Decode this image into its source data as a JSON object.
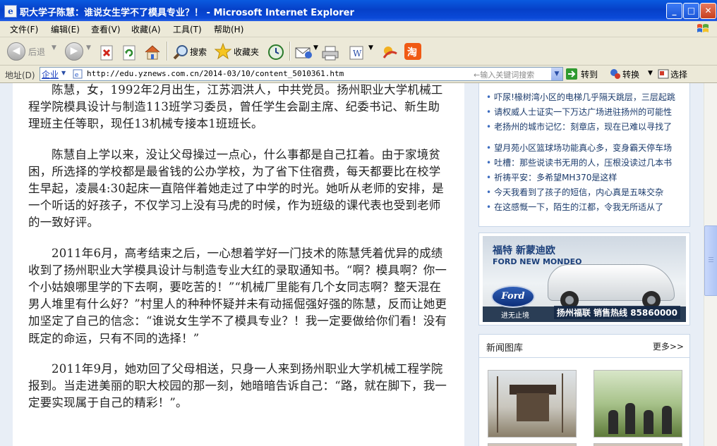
{
  "window": {
    "title": "职大学子陈慧：谁说女生学不了模具专业？！ - Microsoft Internet Explorer",
    "icon": "ie-page-icon",
    "buttons": [
      "minimize",
      "maximize",
      "close"
    ]
  },
  "menu": [
    "文件(F)",
    "编辑(E)",
    "查看(V)",
    "收藏(A)",
    "工具(T)",
    "帮助(H)"
  ],
  "toolbar": {
    "back_label": "后退",
    "search_label": "搜索",
    "favorites_label": "收藏夹"
  },
  "address": {
    "label": "地址(D)",
    "scope": "企业",
    "url": "http://edu.yznews.com.cn/2014-03/10/content_5010361.htm",
    "hint": "←输入关键词搜索",
    "go_label": "转到",
    "jump_label": "转换",
    "select_label": "选择"
  },
  "article": {
    "paragraphs": [
      "陈慧，女，1992年2月出生，江苏泗洪人，中共党员。扬州职业大学机械工程学院模具设计与制造113班学习委员，曾任学生会副主席、纪委书记、新生助理班主任等职，现任13机械专接本1班班长。",
      "陈慧自上学以来，没让父母操过一点心，什么事都是自己扛着。由于家境贫困，所选择的学校都是最省钱的公办学校，为了省下住宿费，每天都要比在校学生早起，凌晨4:30起床一直陪伴着她走过了中学的时光。她听从老师的安排，是一个听话的好孩子，不仅学习上没有马虎的时候，作为班级的课代表也受到老师的一致好评。",
      "2011年6月，高考结束之后，一心想着学好一门技术的陈慧凭着优异的成绩收到了扬州职业大学模具设计与制造专业大红的录取通知书。“啊？模具啊？你一个小姑娘哪里学的下去啊，要吃苦的！”“机械厂里能有几个女同志啊？整天混在男人堆里有什么好？”村里人的种种怀疑并未有动摇倔强好强的陈慧，反而让她更加坚定了自己的信念：“谁说女生学不了模具专业？！我一定要做给你们看！没有既定的命运，只有不同的选择！”",
      "2011年9月，她劝回了父母相送，只身一人来到扬州职业大学机械工程学院报到。当走进美丽的职大校园的那一刻，她暗暗告诉自己：“路，就在脚下，我一定要实现属于自己的精彩！”。"
    ]
  },
  "sidebar": {
    "news": [
      "吓尿!椽树湾小区的电梯几乎隔天跳层，三层起跳",
      "请权威人士证实一下万达广场进驻扬州的可能性",
      "老扬州的城市记忆：刻章店，现在已难以寻找了",
      "望月苑小区篮球场功能真心多，变身霸天停车场",
      "吐槽：那些说读书无用的人，压根没读过几本书",
      "祈祷平安：多希望MH370是这样",
      "今天我看到了孩子的短信，内心真是五味交杂",
      "在这感慨一下，陌生的江都，令我无所适从了"
    ],
    "ad": {
      "brand": "福特 新蒙迪欧",
      "model": "FORD NEW MONDEO",
      "logo": "Ford",
      "slogan": "进无止境",
      "dealer": "扬州福联 销售热线 85860000"
    },
    "gallery": {
      "title": "新闻图库",
      "more": "更多>>"
    }
  }
}
